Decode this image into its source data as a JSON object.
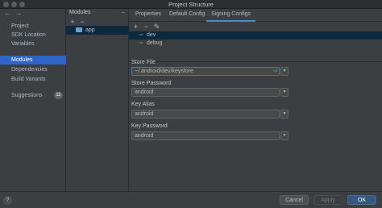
{
  "window": {
    "title": "Project Structure"
  },
  "nav": {
    "back_icon": "arrow-left-icon",
    "forward_icon": "arrow-right-icon",
    "items": [
      {
        "label": "Project"
      },
      {
        "label": "SDK Location"
      },
      {
        "label": "Variables"
      },
      {
        "label": "Modules"
      },
      {
        "label": "Dependencies"
      },
      {
        "label": "Build Variants"
      },
      {
        "label": "Suggestions",
        "badge": "11"
      }
    ]
  },
  "modules": {
    "header": "Modules",
    "collapse_icon": "minus-icon",
    "add_icon": "plus-icon",
    "remove_icon": "minus-icon",
    "items": [
      {
        "label": "app",
        "icon": "folder-icon"
      }
    ]
  },
  "tabs": [
    {
      "label": "Properties"
    },
    {
      "label": "Default Config"
    },
    {
      "label": "Signing Configs",
      "active": true
    }
  ],
  "signing": {
    "toolbar": {
      "add": "+",
      "remove": "−",
      "edit": "✎"
    },
    "configs": [
      {
        "label": "dev",
        "selected": true,
        "icon": "key-icon"
      },
      {
        "label": "debug",
        "selected": false,
        "icon": "key-icon"
      }
    ],
    "fields": {
      "store_file_label": "Store File",
      "store_file_value": "~/.android/dev/keystore",
      "store_password_label": "Store Password",
      "store_password_value": "android",
      "key_alias_label": "Key Alias",
      "key_alias_value": "android",
      "key_password_label": "Key Password",
      "key_password_value": "android"
    }
  },
  "buttons": {
    "help": "?",
    "cancel": "Cancel",
    "apply": "Apply",
    "ok": "OK"
  },
  "colors": {
    "selection": "#2f65ca",
    "accent": "#4a88c7",
    "primary_button": "#365880"
  }
}
